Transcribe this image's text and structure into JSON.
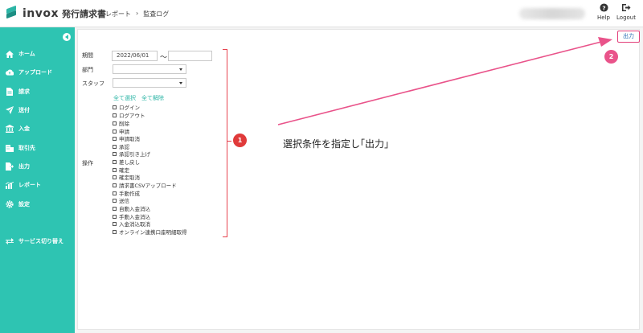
{
  "header": {
    "logo_text": "invox",
    "logo_sub": "発行請求書",
    "breadcrumb": [
      "レポート",
      "›",
      "監査ログ"
    ],
    "help_label": "Help",
    "logout_label": "Logout"
  },
  "sidebar": {
    "items": [
      {
        "label": "ホーム",
        "icon": "home-icon"
      },
      {
        "label": "アップロード",
        "icon": "cloud-upload-icon"
      },
      {
        "label": "請求",
        "icon": "document-icon"
      },
      {
        "label": "送付",
        "icon": "send-icon"
      },
      {
        "label": "入金",
        "icon": "bank-icon"
      },
      {
        "label": "取引先",
        "icon": "building-icon"
      },
      {
        "label": "出力",
        "icon": "export-icon"
      },
      {
        "label": "レポート",
        "icon": "chart-icon"
      },
      {
        "label": "設定",
        "icon": "gear-icon"
      },
      {
        "label": "サービス切り替え",
        "icon": "switch-icon"
      }
    ]
  },
  "form": {
    "period_label": "期間",
    "period_from": "2022/06/01",
    "period_to": "",
    "tilde": "～",
    "department_label": "部門",
    "staff_label": "スタッフ",
    "select_all": "全て選択",
    "deselect_all": "全て解除",
    "operation_label": "操作",
    "operations": [
      "ログイン",
      "ログアウト",
      "削除",
      "申請",
      "申請取消",
      "承認",
      "承認引き上げ",
      "差し戻し",
      "確定",
      "確定取消",
      "請求書CSVアップロード",
      "手動作成",
      "送信",
      "自動入金消込",
      "手動入金消込",
      "入金消込取消",
      "オンライン連携口座明細取得"
    ]
  },
  "output_button": "出力",
  "annotations": {
    "badge1": "1",
    "badge2": "2",
    "instruction": "選択条件を指定し｢出力」"
  },
  "colors": {
    "sidebar": "#2ec4b2",
    "accent": "#2cb5a6",
    "annotation_red": "#e6434f",
    "annotation_pink": "#e9538a"
  }
}
